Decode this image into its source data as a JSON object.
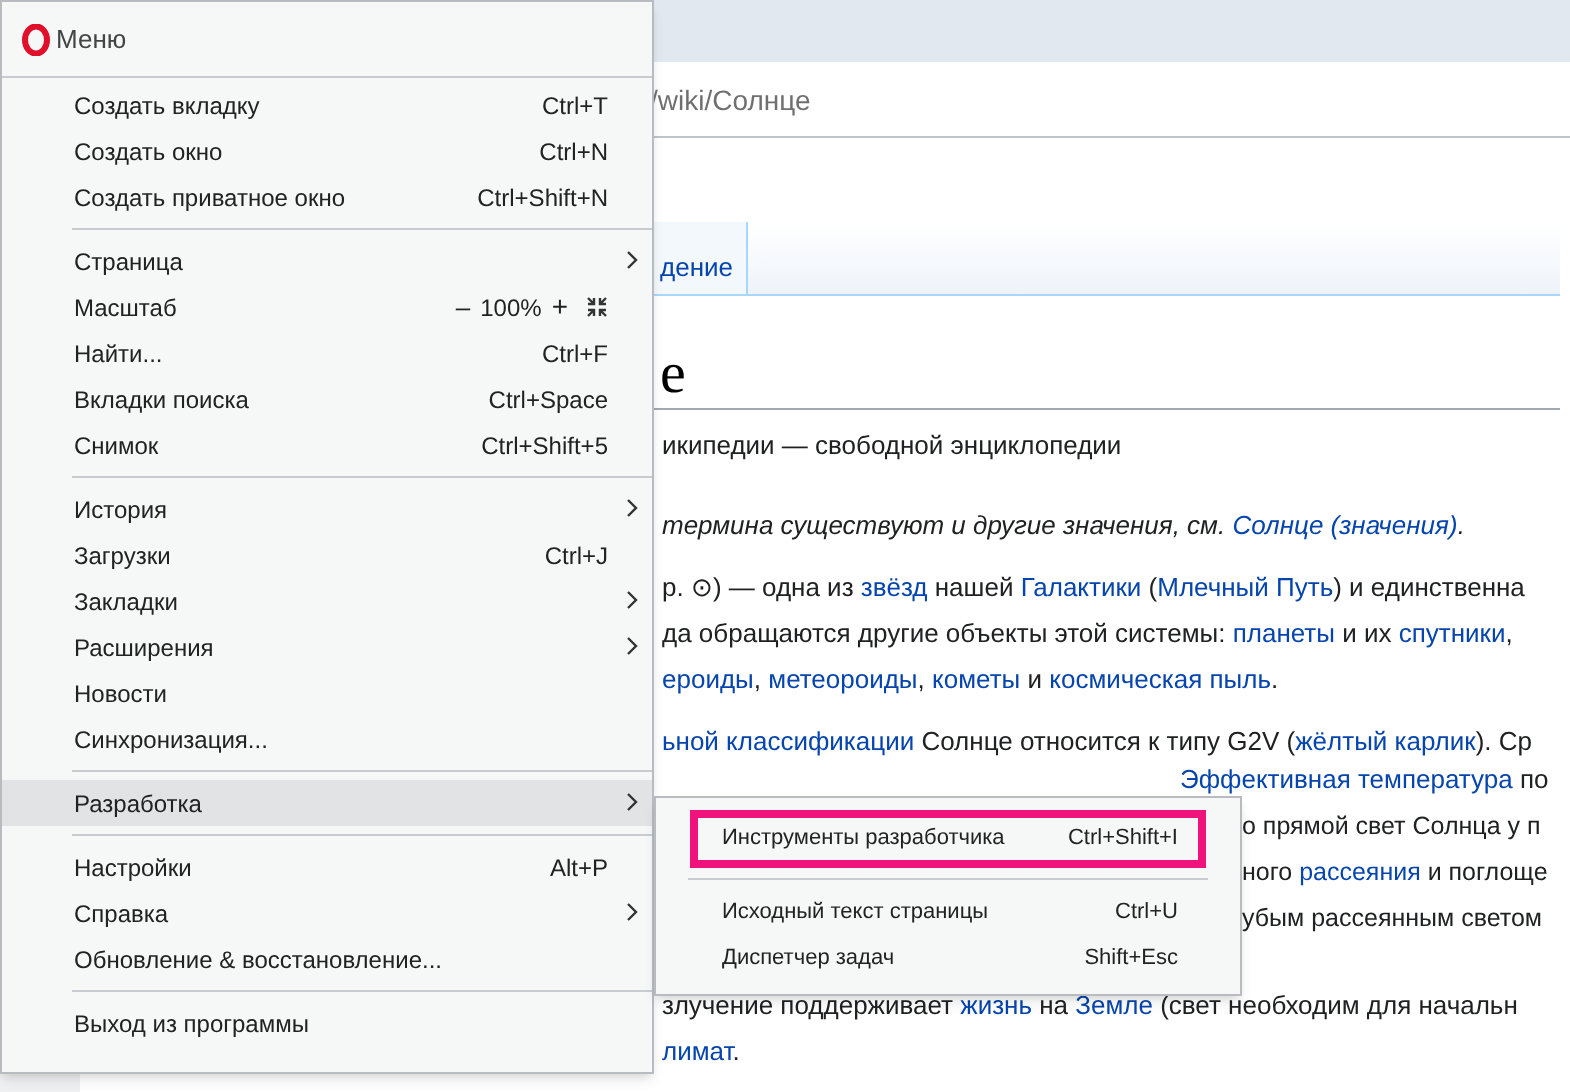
{
  "page": {
    "url": "/wiki/Солнце",
    "tab": "дение",
    "heading": "е",
    "tagline": "икипедии — свободной энциклопедии",
    "lines": [
      {
        "kind": "italic",
        "segments": [
          {
            "text": "термина существуют и другие значения, см. ",
            "link": false
          },
          {
            "text": "Солнце (значения)",
            "link": true
          },
          {
            "text": ".",
            "link": false
          }
        ]
      },
      {
        "kind": "gap",
        "segments": [
          {
            "text": "р. ⊙) — одна из ",
            "link": false
          },
          {
            "text": "звёзд",
            "link": true
          },
          {
            "text": " нашей ",
            "link": false
          },
          {
            "text": "Галактики",
            "link": true
          },
          {
            "text": " (",
            "link": false
          },
          {
            "text": "Млечный Путь",
            "link": true
          },
          {
            "text": ") и единственна",
            "link": false
          }
        ]
      },
      {
        "kind": "plain",
        "segments": [
          {
            "text": "да обращаются другие объекты этой системы: ",
            "link": false
          },
          {
            "text": "планеты",
            "link": true
          },
          {
            "text": " и их ",
            "link": false
          },
          {
            "text": "спутники",
            "link": true
          },
          {
            "text": ",",
            "link": false
          }
        ]
      },
      {
        "kind": "plain",
        "segments": [
          {
            "text": "ероиды",
            "link": true
          },
          {
            "text": ", ",
            "link": false
          },
          {
            "text": "метеороиды",
            "link": true
          },
          {
            "text": ", ",
            "link": false
          },
          {
            "text": "кометы",
            "link": true
          },
          {
            "text": " и ",
            "link": false
          },
          {
            "text": "космическая пыль",
            "link": true
          },
          {
            "text": ".",
            "link": false
          }
        ]
      },
      {
        "kind": "gap",
        "segments": [
          {
            "text": "ьной классификации",
            "link": true
          },
          {
            "text": " Солнце относится к типу G2V (",
            "link": false
          },
          {
            "text": "жёлтый карлик",
            "link": true
          },
          {
            "text": "). Ср",
            "link": false
          }
        ]
      },
      {
        "kind": "upper",
        "segments": [
          {
            "text": "Эффективная температура",
            "link": true
          },
          {
            "text": " по",
            "link": false
          }
        ]
      },
      {
        "kind": "covered",
        "segments": [
          {
            "text": "о прямой свет Солнца у п",
            "link": false
          }
        ]
      },
      {
        "kind": "covered",
        "segments": [
          {
            "text": "ного ",
            "link": false
          },
          {
            "text": "рассеяния",
            "link": true
          },
          {
            "text": " и поглоще",
            "link": false
          }
        ]
      },
      {
        "kind": "covered",
        "segments": [
          {
            "text": "убым рассеянным светом",
            "link": false
          }
        ]
      },
      {
        "kind": "gap2",
        "segments": [
          {
            "text": "злучение поддерживает ",
            "link": false
          },
          {
            "text": "жизнь",
            "link": true
          },
          {
            "text": " на ",
            "link": false
          },
          {
            "text": "Земле",
            "link": true
          },
          {
            "text": " (свет необходим для начальн",
            "link": false
          }
        ]
      },
      {
        "kind": "plain",
        "segments": [
          {
            "text": "лимат",
            "link": true
          },
          {
            "text": ".",
            "link": false
          }
        ]
      }
    ]
  },
  "menu": {
    "title": "Меню",
    "items": [
      {
        "kind": "item",
        "label": "Создать вкладку",
        "shortcut": "Ctrl+T",
        "submenu": false,
        "selected": false
      },
      {
        "kind": "item",
        "label": "Создать окно",
        "shortcut": "Ctrl+N",
        "submenu": false,
        "selected": false
      },
      {
        "kind": "item",
        "label": "Создать приватное окно",
        "shortcut": "Ctrl+Shift+N",
        "submenu": false,
        "selected": false
      },
      {
        "kind": "separator"
      },
      {
        "kind": "item",
        "label": "Страница",
        "submenu": true,
        "selected": false
      },
      {
        "kind": "zoom",
        "label": "Масштаб",
        "minus": "–",
        "value": "100%",
        "plus": "+"
      },
      {
        "kind": "item",
        "label": "Найти...",
        "shortcut": "Ctrl+F",
        "submenu": false,
        "selected": false
      },
      {
        "kind": "item",
        "label": "Вкладки поиска",
        "shortcut": "Ctrl+Space",
        "submenu": false,
        "selected": false
      },
      {
        "kind": "item",
        "label": "Снимок",
        "shortcut": "Ctrl+Shift+5",
        "submenu": false,
        "selected": false
      },
      {
        "kind": "separator"
      },
      {
        "kind": "item",
        "label": "История",
        "submenu": true,
        "selected": false
      },
      {
        "kind": "item",
        "label": "Загрузки",
        "shortcut": "Ctrl+J",
        "submenu": false,
        "selected": false
      },
      {
        "kind": "item",
        "label": "Закладки",
        "submenu": true,
        "selected": false
      },
      {
        "kind": "item",
        "label": "Расширения",
        "submenu": true,
        "selected": false
      },
      {
        "kind": "item",
        "label": "Новости",
        "submenu": false,
        "selected": false
      },
      {
        "kind": "item",
        "label": "Синхронизация...",
        "submenu": false,
        "selected": false
      },
      {
        "kind": "separator"
      },
      {
        "kind": "item",
        "label": "Разработка",
        "submenu": true,
        "selected": true
      },
      {
        "kind": "separator"
      },
      {
        "kind": "item",
        "label": "Настройки",
        "shortcut": "Alt+P",
        "submenu": false,
        "selected": false
      },
      {
        "kind": "item",
        "label": "Справка",
        "submenu": true,
        "selected": false
      },
      {
        "kind": "item",
        "label": "Обновление & восстановление...",
        "submenu": false,
        "selected": false
      },
      {
        "kind": "separator"
      },
      {
        "kind": "item",
        "label": "Выход из программы",
        "submenu": false,
        "selected": false
      }
    ]
  },
  "submenu": {
    "items": [
      {
        "kind": "item",
        "label": "Инструменты разработчика",
        "shortcut": "Ctrl+Shift+I",
        "highlighted": true
      },
      {
        "kind": "separator"
      },
      {
        "kind": "item",
        "label": "Исходный текст страницы",
        "shortcut": "Ctrl+U",
        "highlighted": false
      },
      {
        "kind": "item",
        "label": "Диспетчер задач",
        "shortcut": "Shift+Esc",
        "highlighted": false
      }
    ]
  }
}
